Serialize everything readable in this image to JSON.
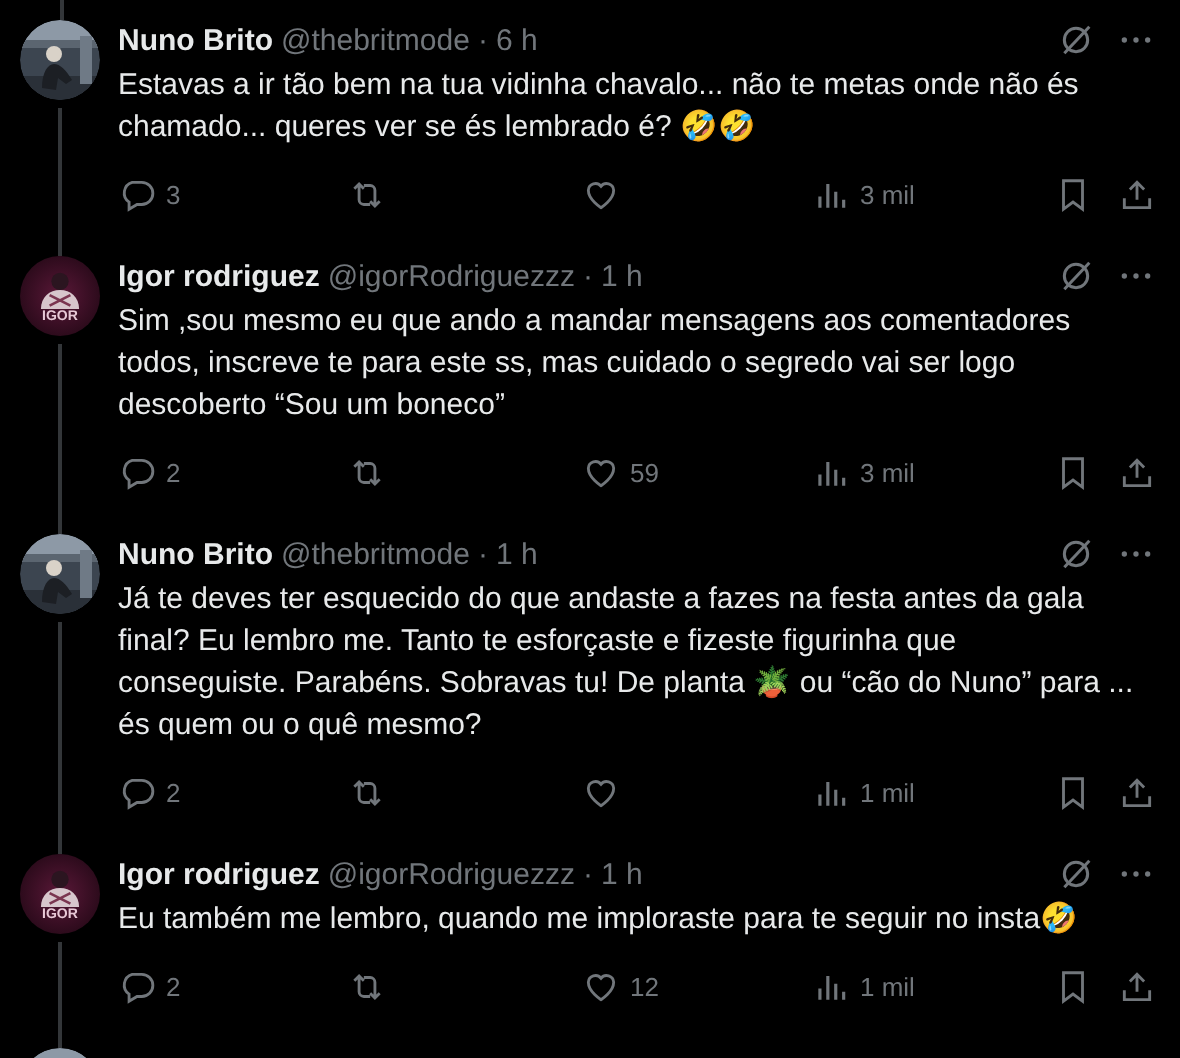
{
  "tweets": [
    {
      "kind": "full",
      "author": "Nuno Brito",
      "handle": "@thebritmode",
      "separator": "·",
      "time": "6 h",
      "avatar": {
        "kind": "picture"
      },
      "lines": [
        "Estavas a ir tão bem na tua vidinha chavalo... não te metas onde não és",
        "chamado... queres ver se és lembrado é? 🤣🤣"
      ],
      "replies": "3",
      "views": "3 mil"
    },
    {
      "kind": "full",
      "author": "Igor rodriguez",
      "handle": "@igorRodriguezzz",
      "separator": "·",
      "time": "1 h",
      "avatar": {
        "kind": "logo",
        "label": "IGOR"
      },
      "lines": [
        "Sim ,sou mesmo eu que ando a mandar mensagens aos comentadores",
        "todos, inscreve te para este ss, mas cuidado o segredo vai ser logo",
        "descoberto “Sou um boneco”"
      ],
      "replies": "2",
      "likes": "59",
      "views": "3 mil"
    },
    {
      "kind": "full",
      "author": "Nuno Brito",
      "handle": "@thebritmode",
      "separator": "·",
      "time": "1 h",
      "avatar": {
        "kind": "picture"
      },
      "lines": [
        "Já te deves ter esquecido do que andaste a fazes na festa antes da gala",
        "final? Eu lembro me. Tanto te esforçaste e fizeste figurinha que",
        "conseguiste. Parabéns. Sobravas tu! De planta 🪴 ou “cão do Nuno” para ...",
        "és quem ou o quê mesmo?"
      ],
      "replies": "2",
      "views": "1 mil"
    },
    {
      "kind": "full",
      "author": "Igor rodriguez",
      "handle": "@igorRodriguezzz",
      "separator": "·",
      "time": "1 h",
      "avatar": {
        "kind": "logo",
        "label": "IGOR"
      },
      "lines": [
        "Eu também me lembro, quando me imploraste para te seguir no insta🤣"
      ],
      "replies": "2",
      "likes": "12",
      "views": "1 mil"
    },
    {
      "kind": "partial",
      "avatar": {
        "kind": "picture"
      }
    }
  ]
}
